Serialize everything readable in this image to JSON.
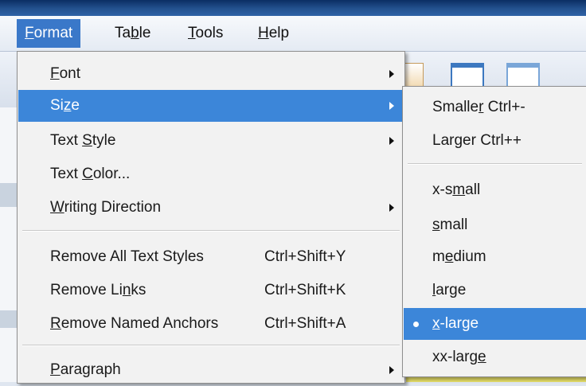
{
  "menubar": {
    "items": [
      {
        "pre": "",
        "acc": "F",
        "post": "ormat"
      },
      {
        "pre": "Ta",
        "acc": "b",
        "post": "le"
      },
      {
        "pre": "",
        "acc": "T",
        "post": "ools"
      },
      {
        "pre": "",
        "acc": "H",
        "post": "elp"
      }
    ]
  },
  "format_menu": {
    "items": [
      {
        "pre": "",
        "acc": "F",
        "post": "ont",
        "submenu": true
      },
      {
        "pre": "Si",
        "acc": "z",
        "post": "e",
        "submenu": true,
        "highlighted": true
      },
      {
        "pre": "Text ",
        "acc": "S",
        "post": "tyle",
        "submenu": true
      },
      {
        "pre": "Text ",
        "acc": "C",
        "post": "olor..."
      },
      {
        "pre": "",
        "acc": "W",
        "post": "riting Direction",
        "submenu": true
      },
      {
        "pre": "Remove All Text Styles",
        "acc": "",
        "post": "",
        "shortcut": "Ctrl+Shift+Y"
      },
      {
        "pre": "Remove Li",
        "acc": "n",
        "post": "ks",
        "shortcut": "Ctrl+Shift+K"
      },
      {
        "pre": "",
        "acc": "R",
        "post": "emove Named Anchors",
        "shortcut": "Ctrl+Shift+A"
      },
      {
        "pre": "",
        "acc": "P",
        "post": "aragraph",
        "submenu": true
      }
    ]
  },
  "size_menu": {
    "items": [
      {
        "pre": "Smalle",
        "acc": "r",
        "post": " Ctrl+-"
      },
      {
        "pre": "Lar",
        "acc": "g",
        "post": "er  Ctrl++"
      },
      {
        "pre": "x-s",
        "acc": "m",
        "post": "all"
      },
      {
        "pre": "",
        "acc": "s",
        "post": "mall"
      },
      {
        "pre": "m",
        "acc": "e",
        "post": "dium"
      },
      {
        "pre": "",
        "acc": "l",
        "post": "arge"
      },
      {
        "pre": "",
        "acc": "x",
        "post": "-large",
        "selected": true,
        "highlighted": true
      },
      {
        "pre": "xx-larg",
        "acc": "e",
        "post": ""
      }
    ]
  }
}
